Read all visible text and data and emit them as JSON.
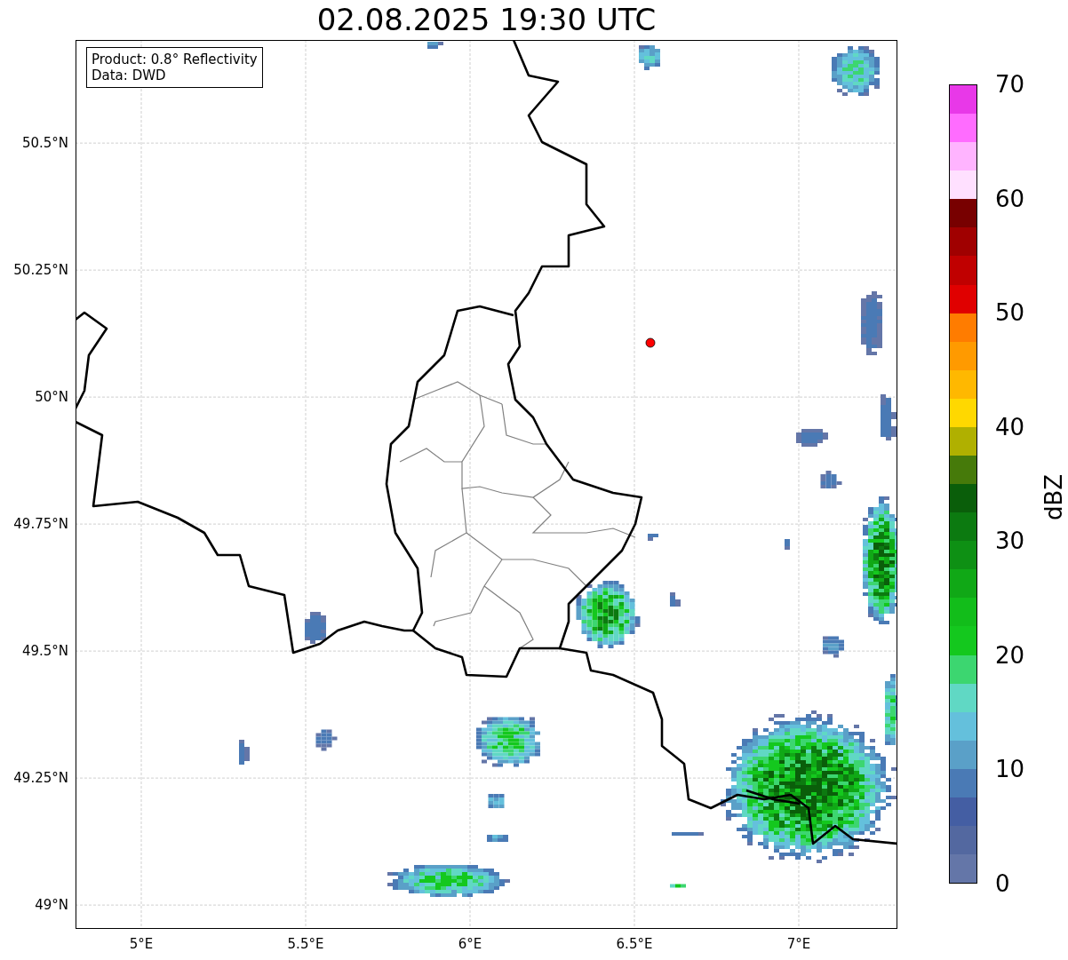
{
  "title": "02.08.2025 19:30 UTC",
  "info_box": [
    "Product: 0.8° Reflectivity",
    "Data: DWD"
  ],
  "map": {
    "x_ticks": [
      "5°E",
      "5.5°E",
      "6°E",
      "6.5°E",
      "7°E"
    ],
    "y_ticks": [
      "50.5°N",
      "50.25°N",
      "50°N",
      "49.75°N",
      "49.5°N",
      "49.25°N",
      "49°N"
    ]
  },
  "colorbar": {
    "label": "dBZ",
    "ticks": [
      "70",
      "60",
      "50",
      "40",
      "30",
      "20",
      "10",
      "0"
    ],
    "bins": [
      {
        "color": "#6476a8"
      },
      {
        "color": "#5368a0"
      },
      {
        "color": "#445ea3"
      },
      {
        "color": "#4a7ab5"
      },
      {
        "color": "#5aa0c8"
      },
      {
        "color": "#64c0dc"
      },
      {
        "color": "#60d8c4"
      },
      {
        "color": "#3cd670"
      },
      {
        "color": "#14c81e"
      },
      {
        "color": "#12bd1a"
      },
      {
        "color": "#10a816"
      },
      {
        "color": "#0e9014"
      },
      {
        "color": "#0c7a10"
      },
      {
        "color": "#0a5e0a"
      },
      {
        "color": "#467a0a"
      },
      {
        "color": "#b0b000"
      },
      {
        "color": "#ffd800"
      },
      {
        "color": "#ffb800"
      },
      {
        "color": "#ff9a00"
      },
      {
        "color": "#ff7c00"
      },
      {
        "color": "#e00000"
      },
      {
        "color": "#c00000"
      },
      {
        "color": "#a00000"
      },
      {
        "color": "#780000"
      },
      {
        "color": "#ffe0ff"
      },
      {
        "color": "#ffb4ff"
      },
      {
        "color": "#ff6cff"
      },
      {
        "color": "#e838e8"
      }
    ]
  }
}
